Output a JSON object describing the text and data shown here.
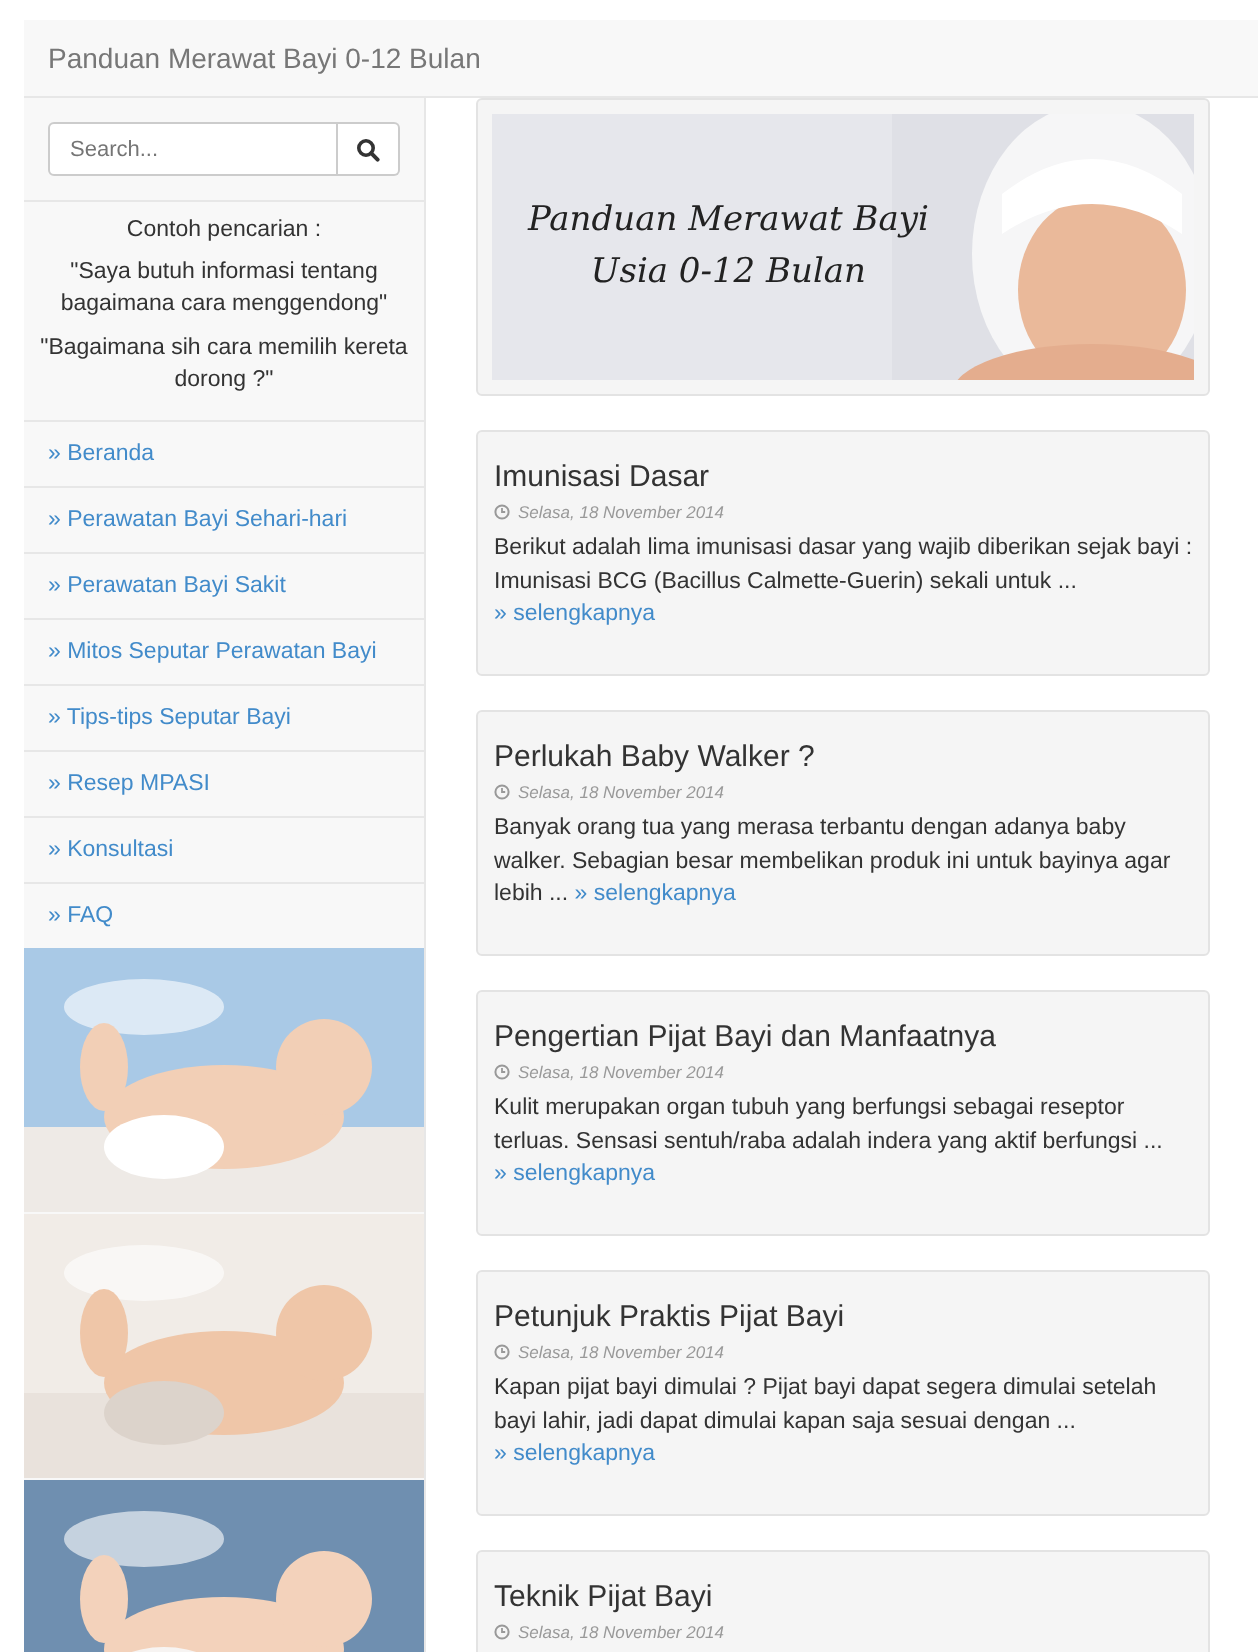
{
  "navbar": {
    "brand": "Panduan Merawat Bayi 0-12 Bulan"
  },
  "sidebar": {
    "search": {
      "placeholder": "Search..."
    },
    "examples_heading": "Contoh pencarian :",
    "examples": [
      "\"Saya butuh informasi tentang bagaimana cara menggendong\"",
      "\"Bagaimana sih cara memilih kereta dorong ?\""
    ],
    "menu": [
      "» Beranda",
      "» Perawatan Bayi Sehari-hari",
      "» Perawatan Bayi Sakit",
      "» Mitos Seputar Perawatan Bayi",
      "» Tips-tips Seputar Bayi",
      "» Resep MPASI",
      "» Konsultasi",
      "» FAQ"
    ],
    "pictures": [
      {
        "kind": "picture"
      },
      {
        "kind": "picture"
      },
      {
        "kind": "picture"
      }
    ]
  },
  "banner": {
    "kind": "picture",
    "title_lines": [
      "Panduan Merawat Bayi",
      "Usia 0-12 Bulan"
    ]
  },
  "posts": [
    {
      "title": "Imunisasi Dasar",
      "date": "Selasa, 18 November 2014",
      "excerpt": "Berikut adalah lima imunisasi dasar yang wajib diberikan sejak bayi : Imunisasi BCG (Bacillus Calmette-Guerin) sekali untuk ...",
      "more": "» selengkapnya"
    },
    {
      "title": "Perlukah Baby Walker ?",
      "date": "Selasa, 18 November 2014",
      "excerpt": "Banyak orang tua yang merasa terbantu dengan adanya baby walker. Sebagian besar membelikan produk ini untuk bayinya agar lebih ...",
      "more": "» selengkapnya"
    },
    {
      "title": "Pengertian Pijat Bayi dan Manfaatnya",
      "date": "Selasa, 18 November 2014",
      "excerpt": "Kulit merupakan organ tubuh yang berfungsi sebagai reseptor terluas. Sensasi sentuh/raba adalah indera yang aktif berfungsi ...",
      "more": "» selengkapnya"
    },
    {
      "title": "Petunjuk Praktis Pijat Bayi",
      "date": "Selasa, 18 November 2014",
      "excerpt": "Kapan pijat bayi dimulai ? Pijat bayi dapat segera dimulai setelah bayi lahir, jadi dapat dimulai kapan saja sesuai dengan ...",
      "more": "» selengkapnya"
    },
    {
      "title": "Teknik Pijat Bayi",
      "date": "Selasa, 18 November 2014"
    }
  ]
}
